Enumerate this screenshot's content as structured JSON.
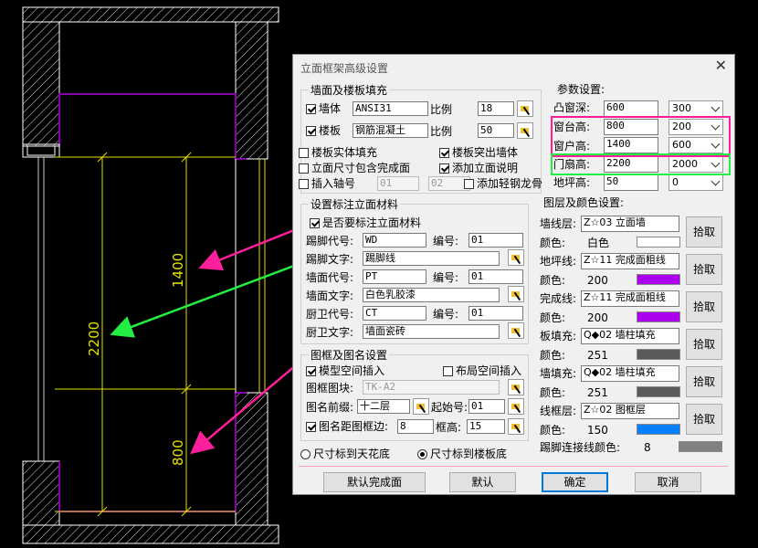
{
  "cad": {
    "dim_1400": "1400",
    "dim_2200": "2200",
    "dim_800": "800",
    "colors": {
      "wall": "#ffffff",
      "frame": "#8800aa",
      "dim": "#e8e000",
      "pink_arrow": "#ff1f9c",
      "green_arrow": "#22ee44"
    }
  },
  "dialog": {
    "title": "立面框架高级设置",
    "wall_floor": {
      "legend": "墙面及楼板填充",
      "wall_label": "墙体",
      "wall_value": "ANSI31",
      "scale_label": "比例",
      "wall_scale": "18",
      "floor_label": "楼板",
      "floor_value": "钢筋混凝土",
      "floor_scale": "50",
      "cb_solid": "楼板实体填充",
      "cb_protrude": "楼板突出墙体",
      "cb_include": "立面尺寸包含完成面",
      "cb_add_desc": "添加立面说明",
      "cb_axis": "插入轴号",
      "axis_from": "01",
      "axis_to": "02",
      "cb_keel": "添加轻钢龙骨"
    },
    "params": {
      "legend": "参数设置:",
      "bay_label": "凸窗深:",
      "bay_value": "600",
      "bay_combo": "300",
      "sill_label": "窗台高:",
      "sill_value": "800",
      "sill_combo": "200",
      "win_label": "窗户高:",
      "win_value": "1400",
      "win_combo": "600",
      "door_label": "门扇高:",
      "door_value": "2200",
      "door_combo": "2000",
      "step_label": "地坪高:",
      "step_value": "50",
      "step_combo": "0"
    },
    "material": {
      "legend": "设置标注立面材料",
      "cb_mark": "是否要标注立面材料",
      "skirt_code_label": "踢脚代号:",
      "skirt_code": "WD",
      "no_label": "编号:",
      "skirt_no": "01",
      "skirt_text_label": "踢脚文字:",
      "skirt_text": "踢脚线",
      "wall_code_label": "墙面代号:",
      "wall_code": "PT",
      "wall_no": "01",
      "wall_text_label": "墙面文字:",
      "wall_text": "白色乳胶漆",
      "bath_code_label": "厨卫代号:",
      "bath_code": "CT",
      "bath_no": "01",
      "bath_text_label": "厨卫文字:",
      "bath_text": "墙面瓷砖"
    },
    "frame": {
      "legend": "图框及图名设置",
      "cb_model": "模型空间插入",
      "cb_layout": "布局空间插入",
      "block_label": "图框图块:",
      "block_value": "TK-A2",
      "prefix_label": "图名前缀:",
      "prefix_value": "十二层",
      "start_label": "起始号:",
      "start_value": "01",
      "cb_gap": "图名距图框边:",
      "gap_value": "8",
      "height_label": "框高:",
      "height_value": "15"
    },
    "layers": {
      "legend": "图层及颜色设置:",
      "pick_label": "拾取",
      "color_label": "颜色:",
      "rows": [
        {
          "label": "墙线层:",
          "value": "Z☆03 立面墙",
          "color_name": "白色",
          "color": "#ffffff"
        },
        {
          "label": "地坪线:",
          "value": "Z☆11 完成面粗线",
          "color_name": "200",
          "color": "#aa00ee"
        },
        {
          "label": "完成线:",
          "value": "Z☆11 完成面粗线",
          "color_name": "200",
          "color": "#aa00ee"
        },
        {
          "label": "板填充:",
          "value": "Q◆02 墙柱填充",
          "color_name": "251",
          "color": "#5a5a5a"
        },
        {
          "label": "墙填充:",
          "value": "Q◆02 墙柱填充",
          "color_name": "251",
          "color": "#5a5a5a"
        },
        {
          "label": "线框层:",
          "value": "Z☆02 图框层",
          "color_name": "150",
          "color": "#0080ff"
        }
      ],
      "skirt_color_label": "踢脚连接线颜色:",
      "skirt_color_value": "8",
      "skirt_color": "#808080"
    },
    "radio_ceiling": "尺寸标到天花底",
    "radio_floor": "尺寸标到楼板底",
    "buttons": {
      "default_finish": "默认完成面",
      "default": "默认",
      "ok": "确定",
      "cancel": "取消"
    }
  }
}
